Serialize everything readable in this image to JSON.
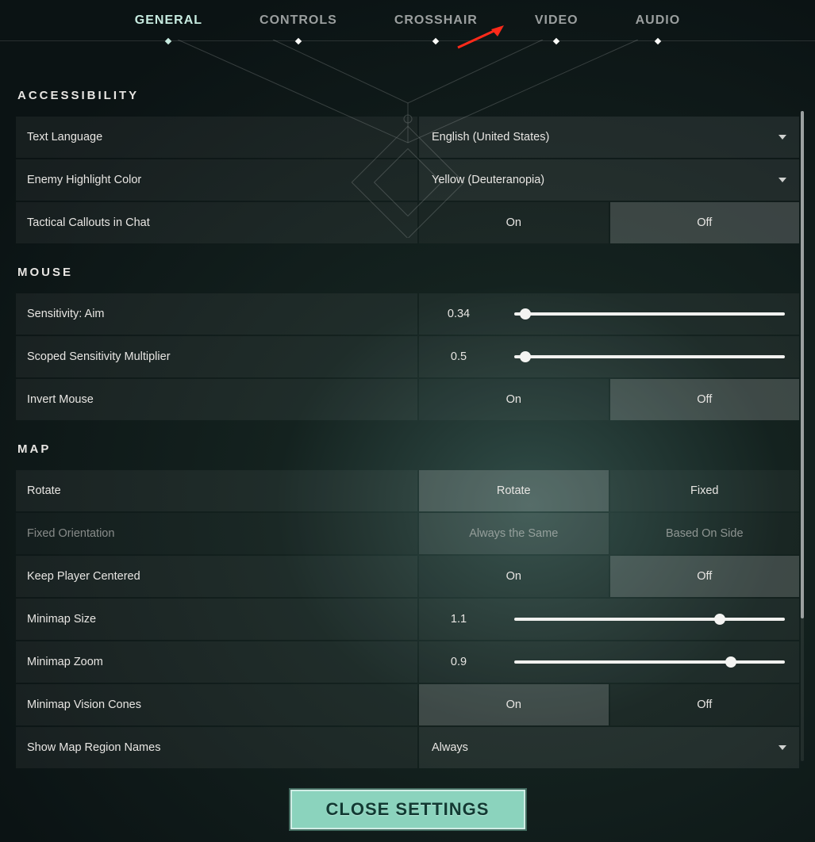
{
  "tabs": {
    "general": "GENERAL",
    "controls": "CONTROLS",
    "crosshair": "CROSSHAIR",
    "video": "VIDEO",
    "audio": "AUDIO"
  },
  "sections": {
    "accessibility": "ACCESSIBILITY",
    "mouse": "MOUSE",
    "map": "MAP"
  },
  "accessibility": {
    "text_language_label": "Text Language",
    "text_language_value": "English (United States)",
    "enemy_highlight_label": "Enemy Highlight Color",
    "enemy_highlight_value": "Yellow (Deuteranopia)",
    "tactical_callouts_label": "Tactical Callouts in Chat",
    "tactical_callouts_on": "On",
    "tactical_callouts_off": "Off",
    "tactical_callouts_selected": "Off"
  },
  "mouse": {
    "sens_label": "Sensitivity: Aim",
    "sens_value": "0.34",
    "sens_pct": 4,
    "scoped_label": "Scoped Sensitivity Multiplier",
    "scoped_value": "0.5",
    "scoped_pct": 4,
    "invert_label": "Invert Mouse",
    "invert_on": "On",
    "invert_off": "Off",
    "invert_selected": "Off"
  },
  "map": {
    "rotate_label": "Rotate",
    "rotate_opt_rotate": "Rotate",
    "rotate_opt_fixed": "Fixed",
    "rotate_selected": "Rotate",
    "fixedori_label": "Fixed Orientation",
    "fixedori_opt_same": "Always the Same",
    "fixedori_opt_side": "Based On Side",
    "fixedori_selected": "Always the Same",
    "fixedori_disabled": true,
    "keep_label": "Keep Player Centered",
    "keep_on": "On",
    "keep_off": "Off",
    "keep_selected": "Off",
    "size_label": "Minimap Size",
    "size_value": "1.1",
    "size_pct": 76,
    "zoom_label": "Minimap Zoom",
    "zoom_value": "0.9",
    "zoom_pct": 80,
    "cones_label": "Minimap Vision Cones",
    "cones_on": "On",
    "cones_off": "Off",
    "cones_selected": "On",
    "region_label": "Show Map Region Names",
    "region_value": "Always"
  },
  "close_label": "CLOSE SETTINGS"
}
